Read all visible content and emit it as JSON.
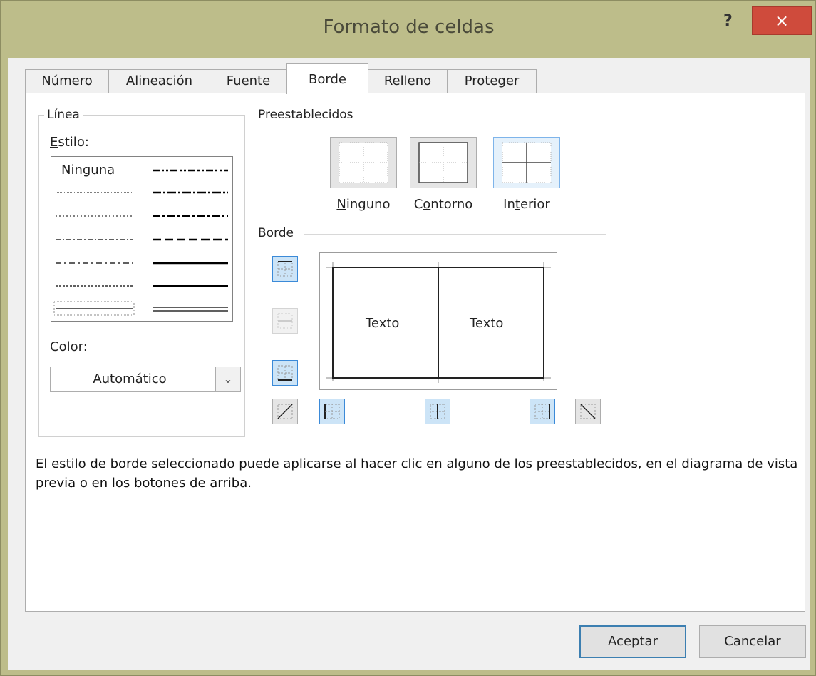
{
  "window": {
    "title": "Formato de celdas",
    "help_label": "?",
    "close_label": "×"
  },
  "tabs": [
    {
      "label": "Número",
      "active": false
    },
    {
      "label": "Alineación",
      "active": false
    },
    {
      "label": "Fuente",
      "active": false
    },
    {
      "label": "Borde",
      "active": true
    },
    {
      "label": "Relleno",
      "active": false
    },
    {
      "label": "Proteger",
      "active": false
    }
  ],
  "linea": {
    "group_title": "Línea",
    "estilo_label_u": "E",
    "estilo_label_rest": "stilo:",
    "none_style_label": "Ninguna",
    "color_label_u": "C",
    "color_label_rest": "olor:",
    "color_value": "Automático",
    "color_arrow": "⌄"
  },
  "presets": {
    "group_title": "Preestablecidos",
    "items": [
      {
        "label_pre": "",
        "label_u": "N",
        "label_post": "inguno"
      },
      {
        "label_pre": "C",
        "label_u": "o",
        "label_post": "ntorno"
      },
      {
        "label_pre": "In",
        "label_u": "t",
        "label_post": "erior"
      }
    ]
  },
  "borde": {
    "group_title": "Borde",
    "preview_text_left": "Texto",
    "preview_text_right": "Texto"
  },
  "info_text": "El estilo de borde seleccionado puede aplicarse al hacer clic en alguno de los preestablecidos, en el diagrama de vista previa o en los botones de arriba.",
  "buttons": {
    "ok": "Aceptar",
    "cancel": "Cancelar"
  },
  "colors": {
    "accent": "#3b8ad8",
    "selection_bg": "#cce4f7",
    "close_red": "#cf4b3c",
    "frame": "#bdbd8a"
  }
}
